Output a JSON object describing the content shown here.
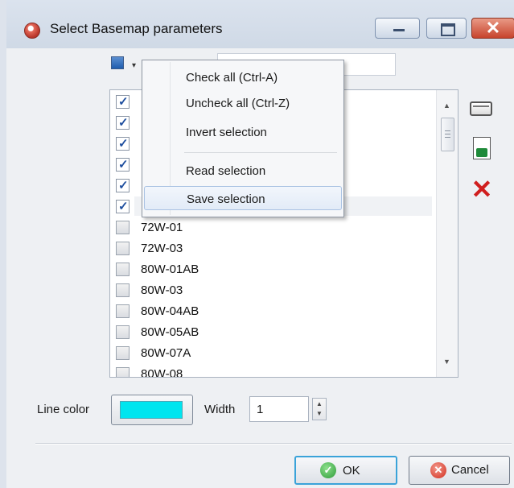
{
  "window": {
    "title": "Select Basemap parameters",
    "close_glyph": "✕",
    "icons": [
      "app-icon",
      "minimize-icon",
      "maximize-icon",
      "close-icon"
    ]
  },
  "toolbar": {
    "select_all_arrow": "▾",
    "filter_value": ""
  },
  "list": {
    "rows": [
      {
        "label": "",
        "checked": true
      },
      {
        "label": "",
        "checked": true
      },
      {
        "label": "",
        "checked": true
      },
      {
        "label": "",
        "checked": true
      },
      {
        "label": "",
        "checked": true
      },
      {
        "label": "",
        "checked": true
      },
      {
        "label": "72W-01",
        "checked": false
      },
      {
        "label": "72W-03",
        "checked": false
      },
      {
        "label": "80W-01AB",
        "checked": false
      },
      {
        "label": "80W-03",
        "checked": false
      },
      {
        "label": "80W-04AB",
        "checked": false
      },
      {
        "label": "80W-05AB",
        "checked": false
      },
      {
        "label": "80W-07A",
        "checked": false
      },
      {
        "label": "80W-08",
        "checked": false
      }
    ],
    "tick_glyph": "✓",
    "scroll_up": "▲",
    "scroll_down": "▼"
  },
  "side_buttons": {
    "icons": [
      "frame-icon",
      "save-file-icon",
      "delete-icon"
    ],
    "delete_glyph": "✕"
  },
  "context_menu": {
    "items": [
      {
        "label": "Check all (Ctrl-A)"
      },
      {
        "label": "Uncheck all (Ctrl-Z)"
      },
      {
        "label": "Invert selection"
      },
      {
        "label": "Read selection"
      },
      {
        "label": "Save selection",
        "highlighted": true
      }
    ]
  },
  "line_settings": {
    "line_color_label": "Line color",
    "line_color": "#00e5ef",
    "width_label": "Width",
    "width_value": "1",
    "spin_up": "▲",
    "spin_down": "▼"
  },
  "dialog_buttons": {
    "ok_label": "OK",
    "cancel_label": "Cancel",
    "ok_glyph": "✓",
    "cancel_glyph": "✕"
  }
}
